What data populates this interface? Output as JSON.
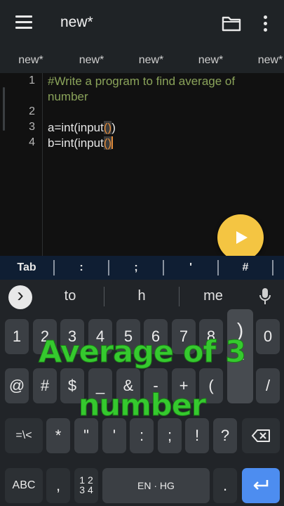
{
  "header": {
    "title": "new*"
  },
  "tabs": [
    "new*",
    "new*",
    "new*",
    "new*",
    "new*"
  ],
  "editor": {
    "line_numbers": [
      "1",
      "2",
      "3",
      "4"
    ],
    "line1a": "#Write a program to find average of",
    "line1b": "number",
    "line3_text": "a=int(input",
    "line3_paren": "()",
    "line3_close": ")",
    "line4_text": "b=int(input",
    "line4_paren": "()"
  },
  "symbol_bar": [
    "Tab",
    ":",
    ";",
    "'",
    "#"
  ],
  "keyboard": {
    "suggestions": [
      "to",
      "h",
      "me"
    ],
    "row1": [
      "1",
      "2",
      "3",
      "4",
      "5",
      "6",
      "7",
      "8",
      ")",
      "0"
    ],
    "row1_hint": "…",
    "row2": [
      "@",
      "#",
      "$",
      "_",
      "&",
      "-",
      "+",
      "(",
      "/"
    ],
    "row3": [
      "=\\<",
      "*",
      "\"",
      "'",
      ":",
      ";",
      "!",
      "?"
    ],
    "row4": {
      "abc": "ABC",
      "comma": ",",
      "numpad_top": "1 2",
      "numpad_bottom": "3 4",
      "space": "EN · HG",
      "period": "."
    }
  },
  "overlay": {
    "line1": "Average of 3",
    "line2": "number"
  },
  "colors": {
    "run_button": "#f4c542",
    "overlay_text": "#35c92e",
    "enter_key": "#4d8df0"
  }
}
